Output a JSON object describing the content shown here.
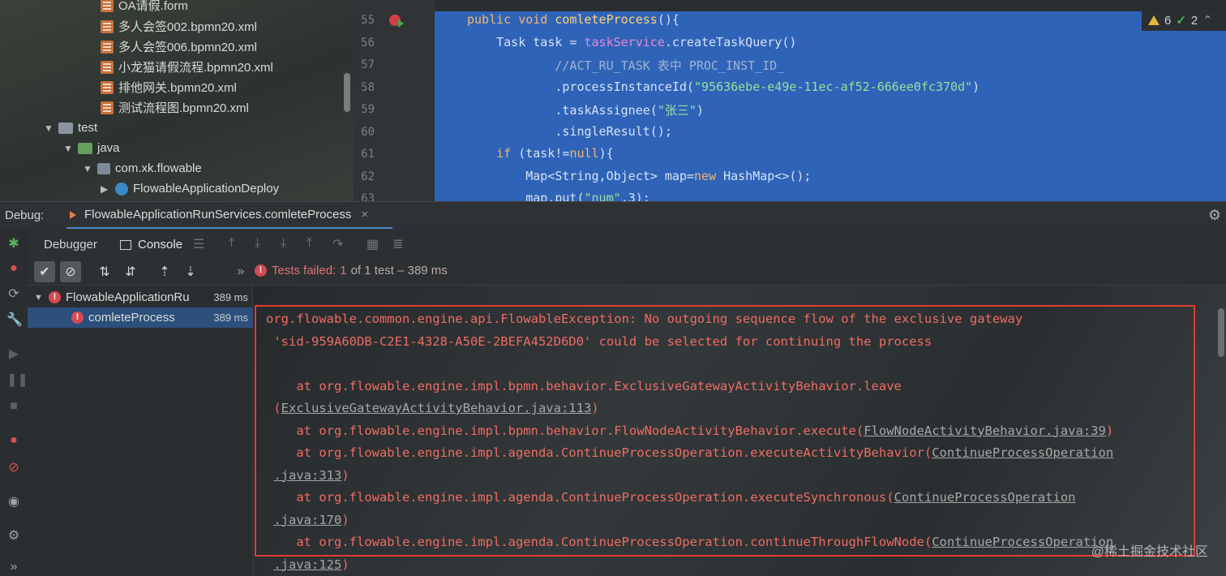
{
  "project_tree": {
    "items": [
      {
        "label": "OA请假.form",
        "type": "file"
      },
      {
        "label": "多人会签002.bpmn20.xml",
        "type": "xml"
      },
      {
        "label": "多人会签006.bpmn20.xml",
        "type": "xml"
      },
      {
        "label": "小龙猫请假流程.bpmn20.xml",
        "type": "xml"
      },
      {
        "label": "排他网关.bpmn20.xml",
        "type": "xml"
      },
      {
        "label": "测试流程图.bpmn20.xml",
        "type": "xml"
      },
      {
        "label": "test",
        "type": "folder"
      },
      {
        "label": "java",
        "type": "source-folder"
      },
      {
        "label": "com.xk.flowable",
        "type": "package"
      },
      {
        "label": "FlowableApplicationDeploy",
        "type": "class"
      }
    ]
  },
  "editor": {
    "line_numbers": [
      "55",
      "56",
      "57",
      "58",
      "59",
      "60",
      "61",
      "62",
      "63"
    ],
    "inspections": {
      "warnings": "6",
      "ok": "2"
    },
    "lines": [
      {
        "tokens": [
          [
            "kw",
            "public void "
          ],
          [
            "fn",
            "comleteProcess"
          ],
          [
            "pl",
            "(){"
          ]
        ]
      },
      {
        "tokens": [
          [
            "pl",
            "    Task task = "
          ],
          [
            "var",
            "taskService"
          ],
          [
            "pl",
            ".createTaskQuery()"
          ]
        ]
      },
      {
        "tokens": [
          [
            "cm",
            "            //ACT_RU_TASK 表中 PROC_INST_ID_"
          ]
        ]
      },
      {
        "tokens": [
          [
            "pl",
            "            .processInstanceId("
          ],
          [
            "str",
            "\"95636ebe-e49e-11ec-af52-666ee0fc370d\""
          ],
          [
            "pl",
            ")"
          ]
        ]
      },
      {
        "tokens": [
          [
            "pl",
            "            .taskAssignee("
          ],
          [
            "str",
            "\"张三\""
          ],
          [
            "pl",
            ")"
          ]
        ]
      },
      {
        "tokens": [
          [
            "pl",
            "            .singleResult();"
          ]
        ]
      },
      {
        "tokens": [
          [
            "kw",
            "    if "
          ],
          [
            "pl",
            "(task!="
          ],
          [
            "kw",
            "null"
          ],
          [
            "pl",
            "){"
          ]
        ]
      },
      {
        "tokens": [
          [
            "pl",
            "        Map<String,Object> map="
          ],
          [
            "kw",
            "new "
          ],
          [
            "pl",
            "HashMap<>();"
          ]
        ]
      },
      {
        "tokens": [
          [
            "pl",
            "        map.put("
          ],
          [
            "str",
            "\"num\""
          ],
          [
            "pl",
            ",3);"
          ]
        ]
      }
    ]
  },
  "debug": {
    "label": "Debug:",
    "tab_title": "FlowableApplicationRunServices.comleteProcess",
    "tabs": {
      "debugger": "Debugger",
      "console": "Console"
    },
    "status": {
      "failed": "Tests failed:",
      "count": "1",
      "rest": "of 1 test – 389 ms"
    },
    "test_tree": [
      {
        "label": "FlowableApplicationRu",
        "duration": "389 ms"
      },
      {
        "label": "comleteProcess",
        "duration": "389 ms"
      }
    ]
  },
  "console": {
    "lines": [
      {
        "text": "org.flowable.common.engine.api.FlowableException: No outgoing sequence flow of the exclusive gateway"
      },
      {
        "text": " 'sid-959A60DB-C2E1-4328-A50E-2BEFA452D6D0' could be selected for continuing the process"
      },
      {
        "text": ""
      },
      {
        "text": "    at org.flowable.engine.impl.bpmn.behavior.ExclusiveGatewayActivityBehavior.leave"
      },
      {
        "text": " (",
        "link": "ExclusiveGatewayActivityBehavior.java:113",
        "after": ")"
      },
      {
        "text": "    at org.flowable.engine.impl.bpmn.behavior.FlowNodeActivityBehavior.execute(",
        "link": "FlowNodeActivityBehavior.java:39",
        "after": ")"
      },
      {
        "text": "    at org.flowable.engine.impl.agenda.ContinueProcessOperation.executeActivityBehavior(",
        "link": "ContinueProcessOperation",
        "after": ""
      },
      {
        "text": " ",
        "link": ".java:313",
        "after": ")"
      },
      {
        "text": "    at org.flowable.engine.impl.agenda.ContinueProcessOperation.executeSynchronous(",
        "link": "ContinueProcessOperation",
        "after": ""
      },
      {
        "text": " ",
        "link": ".java:170",
        "after": ")"
      },
      {
        "text": "    at org.flowable.engine.impl.agenda.ContinueProcessOperation.continueThroughFlowNode(",
        "link": "ContinueProcessOperation",
        "after": ""
      },
      {
        "text": " ",
        "link": ".java:125",
        "after": ")"
      }
    ],
    "watermark": "@稀土掘金技术社区"
  },
  "colors": {
    "error": "#ee6c63",
    "highlight_box": "#e23b34",
    "selection": "#2e63b8",
    "accent": "#4a88c7"
  }
}
